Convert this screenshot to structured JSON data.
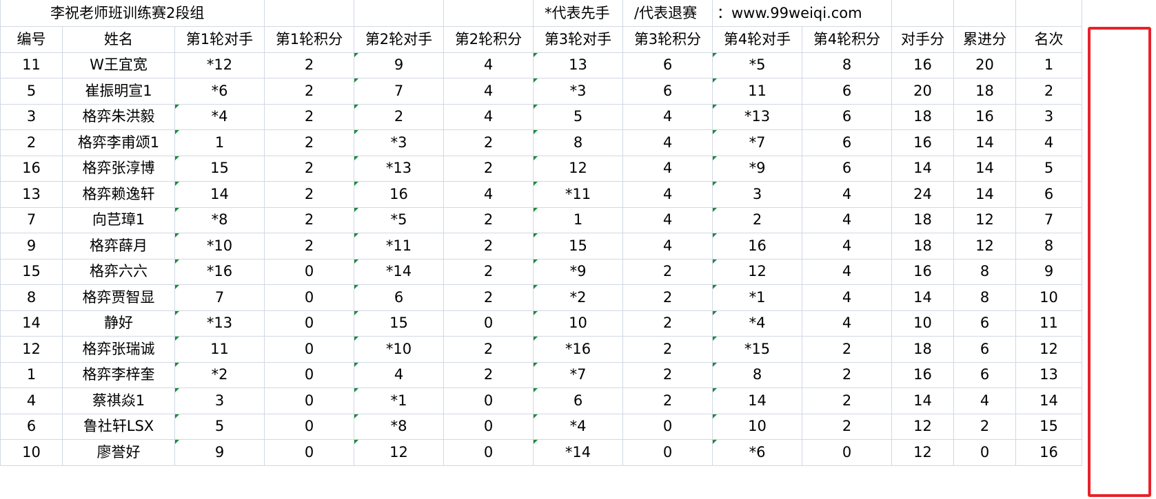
{
  "title": "李祝老师班训练赛2段组",
  "note_first": "*代表先手",
  "note_quit": "/代表退赛",
  "note_site": "：www.99weiqi.com",
  "accent_color": "#e8212b",
  "headers": [
    "编号",
    "姓名",
    "第1轮对手",
    "第1轮积分",
    "第2轮对手",
    "第2轮积分",
    "第3轮对手",
    "第3轮积分",
    "第4轮对手",
    "第4轮积分",
    "对手分",
    "累进分",
    "名次"
  ],
  "rows": [
    [
      "11",
      "W王宜宽",
      "*12",
      "2",
      "9",
      "4",
      "13",
      "6",
      "*5",
      "8",
      "16",
      "20",
      "1"
    ],
    [
      "5",
      "崔振明宣1",
      "*6",
      "2",
      "7",
      "4",
      "*3",
      "6",
      "11",
      "6",
      "20",
      "18",
      "2"
    ],
    [
      "3",
      "格弈朱洪毅",
      "*4",
      "2",
      "2",
      "4",
      "5",
      "4",
      "*13",
      "6",
      "18",
      "16",
      "3"
    ],
    [
      "2",
      "格弈李甫颂1",
      "1",
      "2",
      "*3",
      "2",
      "8",
      "4",
      "*7",
      "6",
      "16",
      "14",
      "4"
    ],
    [
      "16",
      "格弈张淳博",
      "15",
      "2",
      "*13",
      "2",
      "12",
      "4",
      "*9",
      "6",
      "14",
      "14",
      "5"
    ],
    [
      "13",
      "格弈赖逸轩",
      "14",
      "2",
      "16",
      "4",
      "*11",
      "4",
      "3",
      "4",
      "24",
      "14",
      "6"
    ],
    [
      "7",
      "向芑璋1",
      "*8",
      "2",
      "*5",
      "2",
      "1",
      "4",
      "2",
      "4",
      "18",
      "12",
      "7"
    ],
    [
      "9",
      "格弈薛月",
      "*10",
      "2",
      "*11",
      "2",
      "15",
      "4",
      "16",
      "4",
      "18",
      "12",
      "8"
    ],
    [
      "15",
      "格弈六六",
      "*16",
      "0",
      "*14",
      "2",
      "*9",
      "2",
      "12",
      "4",
      "16",
      "8",
      "9"
    ],
    [
      "8",
      "格弈贾智显",
      "7",
      "0",
      "6",
      "2",
      "*2",
      "2",
      "*1",
      "4",
      "14",
      "8",
      "10"
    ],
    [
      "14",
      "静好",
      "*13",
      "0",
      "15",
      "0",
      "10",
      "2",
      "*4",
      "4",
      "10",
      "6",
      "11"
    ],
    [
      "12",
      "格弈张瑞诚",
      "11",
      "0",
      "*10",
      "2",
      "*16",
      "2",
      "*15",
      "2",
      "18",
      "6",
      "12"
    ],
    [
      "1",
      "格弈李梓奎",
      "*2",
      "0",
      "4",
      "2",
      "*7",
      "2",
      "8",
      "2",
      "16",
      "6",
      "13"
    ],
    [
      "4",
      "蔡祺焱1",
      "3",
      "0",
      "*1",
      "0",
      "6",
      "2",
      "14",
      "2",
      "14",
      "4",
      "14"
    ],
    [
      "6",
      "鲁社轩LSX",
      "5",
      "0",
      "*8",
      "0",
      "*4",
      "0",
      "10",
      "2",
      "12",
      "2",
      "15"
    ],
    [
      "10",
      "廖誉好",
      "9",
      "0",
      "12",
      "0",
      "*14",
      "0",
      "*6",
      "0",
      "12",
      "0",
      "16"
    ]
  ]
}
